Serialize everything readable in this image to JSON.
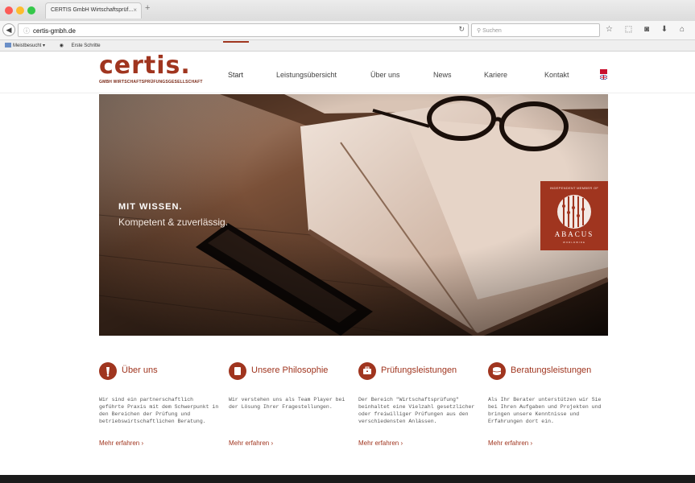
{
  "browser": {
    "tab_title": "CERTIS GmbH Wirtschaftsprüf...",
    "tab_close": "×",
    "new_tab": "+",
    "url_host": "certis-gmbh.de",
    "search_placeholder": "Suchen",
    "bookmarks": [
      "Meistbesucht ▾",
      "Erste Schritte"
    ],
    "toolbar_icons": "☆ ⬚ ◙ ⬇ ⌂ ○ ≡"
  },
  "site": {
    "logo_text": "certis.",
    "logo_subtitle": "GMBH WIRTSCHAFTSPRÜFUNGSGESELLSCHAFT",
    "nav": [
      "Start",
      "Leistungsübersicht",
      "Über uns",
      "News",
      "Kariere",
      "Kontakt"
    ],
    "language_icon": "uk-flag-icon"
  },
  "hero": {
    "title": "MIT WISSEN.",
    "subtitle": "Kompetent & zuverlässig.",
    "badge_top": "INDEPENDENT MEMBER OF",
    "badge_name": "ABACUS",
    "badge_sub": "WORLDWIDE"
  },
  "features": [
    {
      "title": "Über uns",
      "icon": "pen-icon",
      "text": "Wir sind ein partnerschaftlich geführte Praxis mit dem Schwerpunkt in den Bereichen der Prüfung und betriebswirtschaftlichen Beratung.",
      "link": "Mehr erfahren  ›"
    },
    {
      "title": "Unsere Philosophie",
      "icon": "square-icon",
      "text": "Wir verstehen uns als Team Player bei der Lösung Ihrer Fragestellungen.",
      "link": "Mehr erfahren  ›"
    },
    {
      "title": "Prüfungsleistungen",
      "icon": "briefcase-icon",
      "text": "Der Bereich \"Wirtschaftsprüfung\" beinhaltet eine Vielzahl gesetzlicher oder freiwilliger Prüfungen aus den verschiedensten Anlässen.",
      "link": "Mehr erfahren  ›"
    },
    {
      "title": "Beratungsleistungen",
      "icon": "coins-icon",
      "text": "Als Ihr Berater unterstützen wir Sie bei Ihren Aufgaben und Projekten und bringen unsere Kenntnisse und Erfahrungen dort ein.",
      "link": "Mehr erfahren  ›"
    }
  ],
  "colors": {
    "brand": "#a0351f",
    "footer": "#1b1b1b"
  }
}
